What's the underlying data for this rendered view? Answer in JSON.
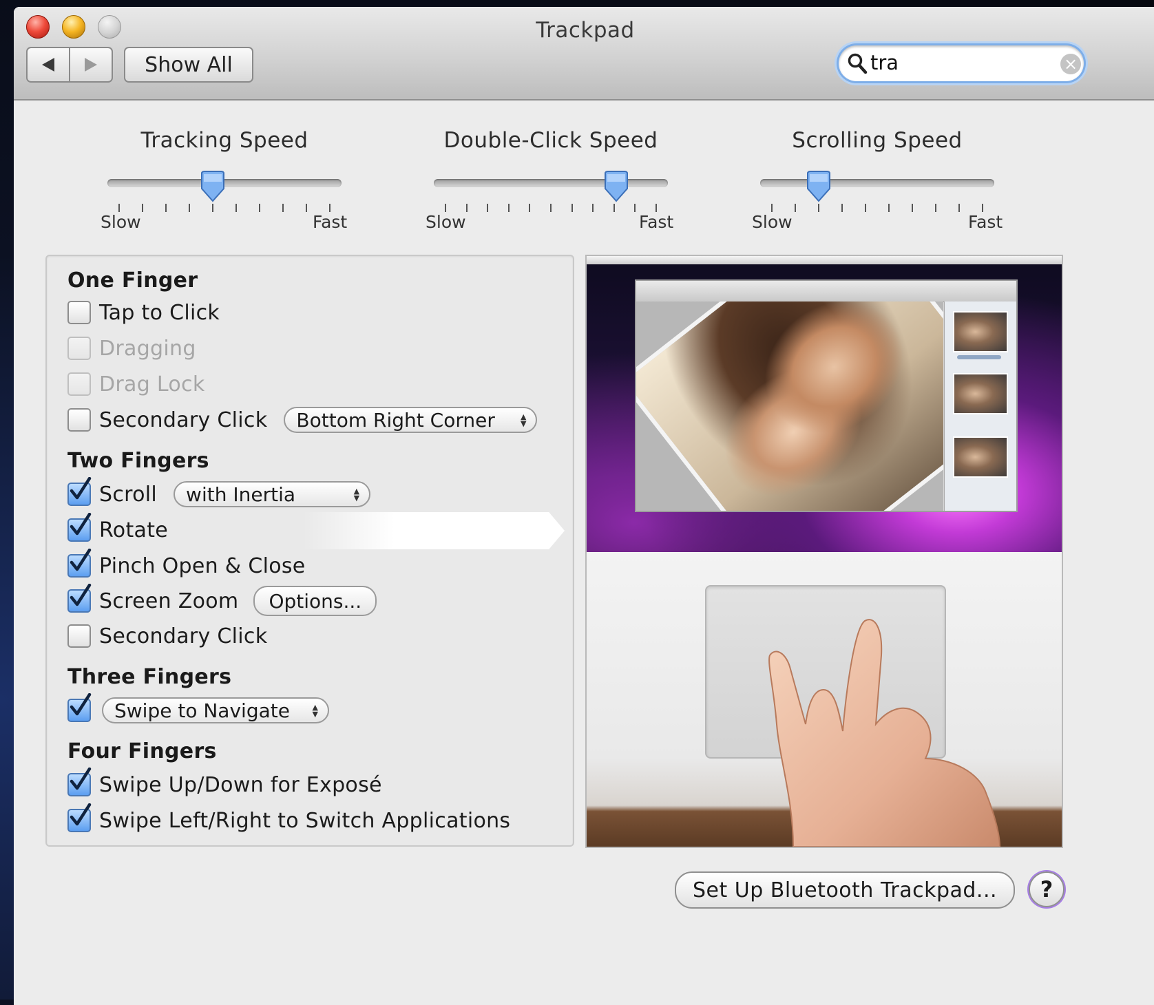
{
  "window": {
    "title": "Trackpad",
    "show_all_label": "Show All",
    "search": {
      "value": "tra"
    }
  },
  "sliders": [
    {
      "label": "Tracking Speed",
      "min_label": "Slow",
      "max_label": "Fast",
      "value_fraction": 0.45,
      "ticks": 10
    },
    {
      "label": "Double-Click Speed",
      "min_label": "Slow",
      "max_label": "Fast",
      "value_fraction": 0.78,
      "ticks": 11
    },
    {
      "label": "Scrolling Speed",
      "min_label": "Slow",
      "max_label": "Fast",
      "value_fraction": 0.25,
      "ticks": 10
    }
  ],
  "one_finger": {
    "heading": "One Finger",
    "tap_to_click": {
      "label": "Tap to Click",
      "checked": false
    },
    "dragging": {
      "label": "Dragging",
      "checked": false,
      "enabled": false
    },
    "drag_lock": {
      "label": "Drag Lock",
      "checked": false,
      "enabled": false
    },
    "secondary_click": {
      "label": "Secondary Click",
      "checked": false,
      "popup": "Bottom Right Corner"
    }
  },
  "two_fingers": {
    "heading": "Two Fingers",
    "scroll": {
      "label": "Scroll",
      "checked": true,
      "popup": "with Inertia"
    },
    "rotate": {
      "label": "Rotate",
      "checked": true
    },
    "pinch": {
      "label": "Pinch Open & Close",
      "checked": true
    },
    "screen_zoom": {
      "label": "Screen Zoom",
      "checked": true,
      "options_label": "Options..."
    },
    "secondary_click": {
      "label": "Secondary Click",
      "checked": false
    }
  },
  "three_fingers": {
    "heading": "Three Fingers",
    "swipe": {
      "checked": true,
      "popup": "Swipe to Navigate"
    }
  },
  "four_fingers": {
    "heading": "Four Fingers",
    "expose": {
      "label": "Swipe Up/Down for Exposé",
      "checked": true
    },
    "switch_apps": {
      "label": "Swipe Left/Right to Switch Applications",
      "checked": true
    }
  },
  "footer": {
    "bluetooth_label": "Set Up Bluetooth Trackpad...",
    "help_label": "?"
  },
  "colors": {
    "accent_blue": "#5c9ef0",
    "search_focus": "#7eaee8",
    "help_ring": "#a67ce6"
  },
  "icons": [
    "back-arrow-icon",
    "forward-arrow-icon",
    "search-icon",
    "clear-icon",
    "checkmark-icon",
    "popup-arrows-icon",
    "help-icon"
  ]
}
